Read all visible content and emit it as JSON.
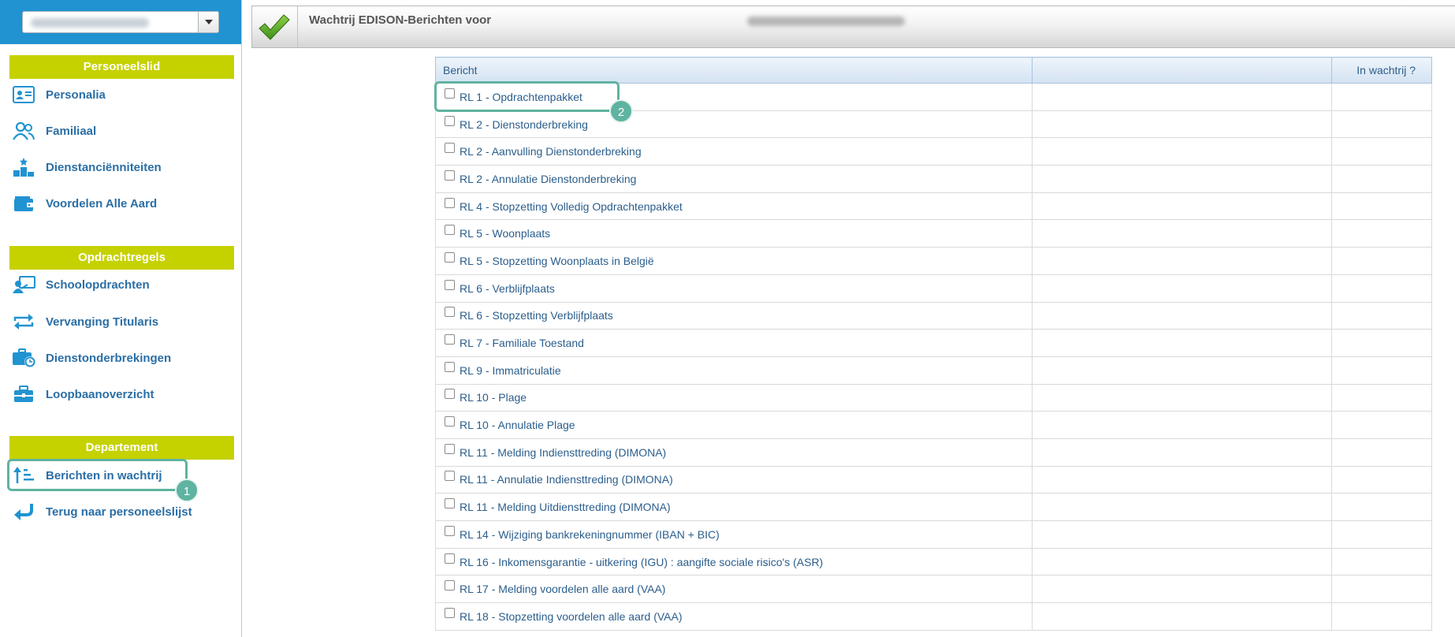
{
  "sidebar": {
    "sections": [
      {
        "title": "Personeelslid",
        "items": [
          {
            "label": "Personalia",
            "icon": "id-card-icon"
          },
          {
            "label": "Familiaal",
            "icon": "users-icon"
          },
          {
            "label": "Dienstanciënniteiten",
            "icon": "podium-icon"
          },
          {
            "label": "Voordelen Alle Aard",
            "icon": "wallet-icon"
          }
        ]
      },
      {
        "title": "Opdrachtregels",
        "items": [
          {
            "label": "Schoolopdrachten",
            "icon": "teacher-icon"
          },
          {
            "label": "Vervanging Titularis",
            "icon": "swap-arrows-icon"
          },
          {
            "label": "Dienstonderbrekingen",
            "icon": "briefcase-clock-icon"
          },
          {
            "label": "Loopbaanoverzicht",
            "icon": "briefcase-icon"
          }
        ]
      },
      {
        "title": "Departement",
        "items": [
          {
            "label": "Berichten in wachtrij",
            "icon": "sort-ascending-icon"
          },
          {
            "label": "Terug naar personeelslijst",
            "icon": "return-arrow-icon"
          }
        ]
      }
    ]
  },
  "header": {
    "title": "Wachtrij EDISON-Berichten voor"
  },
  "table": {
    "columns": [
      "Bericht",
      "",
      "In wachtrij ?"
    ],
    "rows": [
      "RL 1 - Opdrachtenpakket",
      "RL 2 - Dienstonderbreking",
      "RL 2 - Aanvulling Dienstonderbreking",
      "RL 2 - Annulatie Dienstonderbreking",
      "RL 4 - Stopzetting Volledig Opdrachtenpakket",
      "RL 5 - Woonplaats",
      "RL 5 - Stopzetting Woonplaats in België",
      "RL 6 - Verblijfplaats",
      "RL 6 - Stopzetting Verblijfplaats",
      "RL 7 - Familiale Toestand",
      "RL 9 - Immatriculatie",
      "RL 10 - Plage",
      "RL 10 - Annulatie Plage",
      "RL 11 - Melding Indiensttreding (DIMONA)",
      "RL 11 - Annulatie Indiensttreding (DIMONA)",
      "RL 11 - Melding Uitdiensttreding (DIMONA)",
      "RL 14 - Wijziging bankrekeningnummer (IBAN + BIC)",
      "RL 16 - Inkomensgarantie - uitkering (IGU) : aangifte sociale risico's (ASR)",
      "RL 17 - Melding voordelen alle aard (VAA)",
      "RL 18 - Stopzetting voordelen alle aard (VAA)"
    ]
  },
  "annotations": [
    "1",
    "2"
  ],
  "colors": {
    "sidebar_top": "#2193d1",
    "section_header": "#c6d100",
    "nav_text": "#2a6ea5",
    "highlight": "#5fb3a0"
  }
}
